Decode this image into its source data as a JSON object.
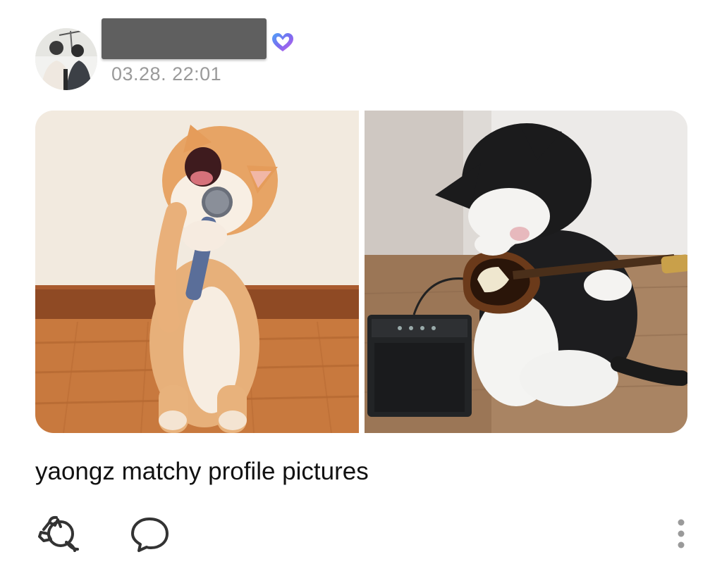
{
  "post": {
    "author": {
      "avatar_icon": "profile-photo",
      "display_name": "",
      "verified_icon": "heart-badge-icon",
      "verified_color": "#7a6cf0"
    },
    "timestamp": "03.28. 22:01",
    "images": [
      {
        "subject": "orange-cat-singing-with-microphone"
      },
      {
        "subject": "black-white-cat-playing-guitar"
      }
    ],
    "caption": "yaongz matchy profile pictures",
    "actions": {
      "react_icon": "add-reaction-icon",
      "comment_icon": "comment-icon",
      "more_icon": "more-vertical-icon"
    }
  }
}
